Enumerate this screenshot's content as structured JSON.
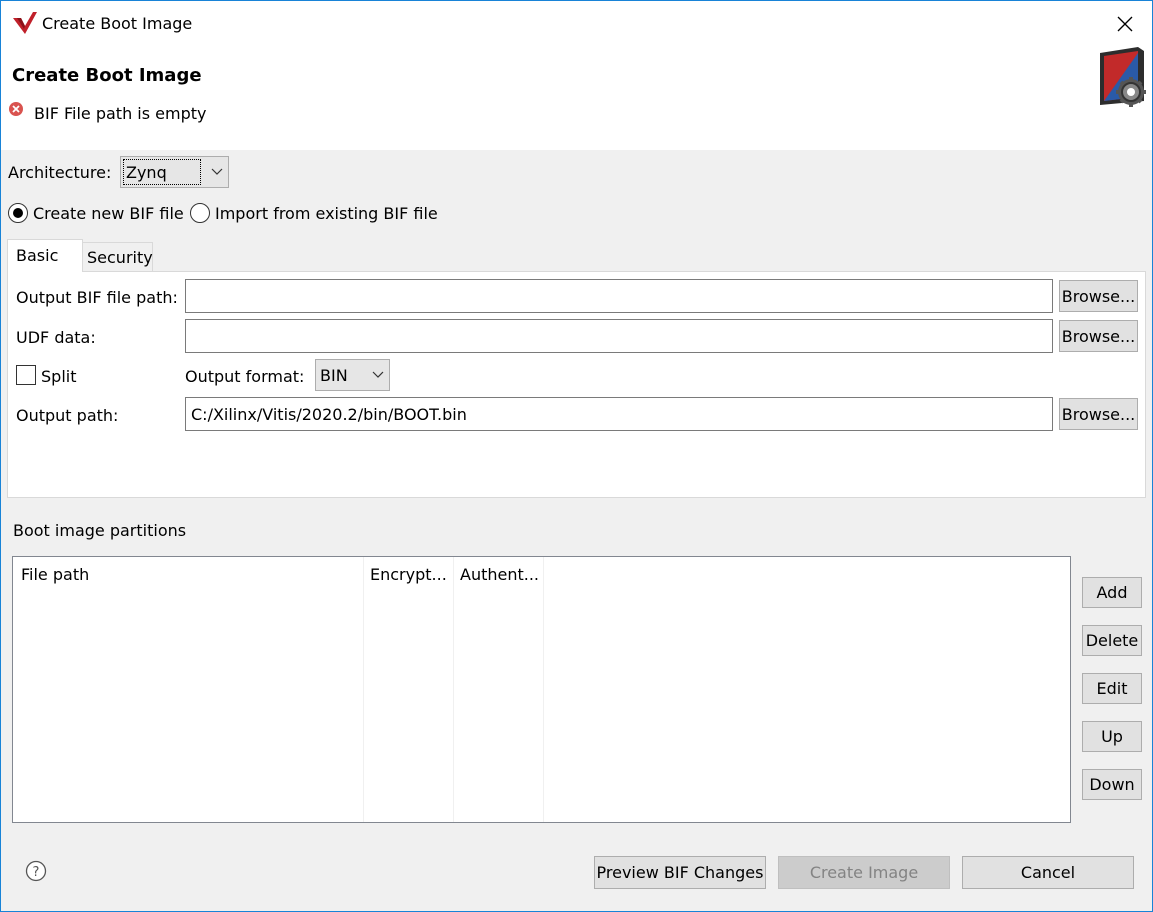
{
  "window": {
    "title": "Create Boot Image",
    "header_title": "Create Boot Image",
    "error_message": "BIF File path is empty"
  },
  "architecture": {
    "label": "Architecture:",
    "value": "Zynq"
  },
  "bif_mode": {
    "create_label": "Create new BIF file",
    "import_label": "Import from existing BIF file",
    "selected": "create"
  },
  "tabs": [
    {
      "label": "Basic",
      "active": true
    },
    {
      "label": "Security",
      "active": false
    }
  ],
  "basic": {
    "output_bif_label": "Output BIF file path:",
    "output_bif_value": "",
    "udf_label": "UDF data:",
    "udf_value": "",
    "split_label": "Split",
    "split_checked": false,
    "output_format_label": "Output format:",
    "output_format_value": "BIN",
    "output_path_label": "Output path:",
    "output_path_value": "C:/Xilinx/Vitis/2020.2/bin/BOOT.bin",
    "browse_label": "Browse..."
  },
  "partitions": {
    "label": "Boot image partitions",
    "columns": [
      "File path",
      "Encrypt...",
      "Authent..."
    ],
    "rows": [],
    "buttons": {
      "add": "Add",
      "delete": "Delete",
      "edit": "Edit",
      "up": "Up",
      "down": "Down"
    }
  },
  "footer": {
    "preview_label": "Preview BIF Changes",
    "create_label": "Create Image",
    "cancel_label": "Cancel"
  },
  "icons": {
    "app": "vitis-logo-icon",
    "close": "close-icon",
    "error": "error-icon",
    "banner": "boot-image-gear-icon",
    "help": "help-icon"
  },
  "colors": {
    "accent": "#1883d7",
    "error": "#d9534f"
  }
}
